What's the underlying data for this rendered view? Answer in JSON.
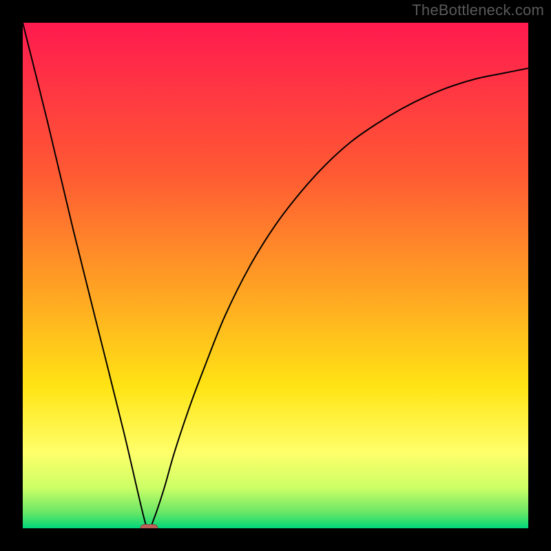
{
  "branding": {
    "watermark_text": "TheBottleneck.com"
  },
  "chart_data": {
    "type": "line",
    "title": "",
    "xlabel": "",
    "ylabel": "",
    "xlim": [
      0,
      100
    ],
    "ylim": [
      0,
      100
    ],
    "grid": false,
    "legend": false,
    "background_gradient": {
      "stops": [
        {
          "offset": 0,
          "color": "#ff1a4f"
        },
        {
          "offset": 30,
          "color": "#ff5a33"
        },
        {
          "offset": 55,
          "color": "#ffaa22"
        },
        {
          "offset": 72,
          "color": "#ffe414"
        },
        {
          "offset": 85,
          "color": "#ffff6a"
        },
        {
          "offset": 92,
          "color": "#ccff66"
        },
        {
          "offset": 97,
          "color": "#66e666"
        },
        {
          "offset": 100,
          "color": "#00d77a"
        }
      ]
    },
    "series": [
      {
        "name": "bottleneck-curve",
        "description": "V-shaped bottleneck curve; left leg is a steep near-linear drop, right leg is a concave rise toward the upper right.",
        "color": "#000000",
        "stroke_width": 2,
        "x": [
          0,
          5,
          10,
          15,
          20,
          24,
          25,
          26,
          28,
          30,
          33,
          36,
          40,
          45,
          50,
          55,
          60,
          65,
          70,
          75,
          80,
          85,
          90,
          95,
          100
        ],
        "y": [
          100,
          80,
          59,
          39,
          19,
          2,
          0,
          2,
          8,
          15,
          24,
          32,
          42,
          52,
          60,
          66.5,
          72,
          76.5,
          80,
          83,
          85.5,
          87.5,
          89,
          90,
          91
        ]
      }
    ],
    "markers": [
      {
        "name": "vertex-marker",
        "shape": "pill",
        "x": 25,
        "y": 0,
        "width": 3.4,
        "height": 1.5,
        "fill": "#bb6158",
        "stroke": "#8a4a44"
      }
    ]
  }
}
